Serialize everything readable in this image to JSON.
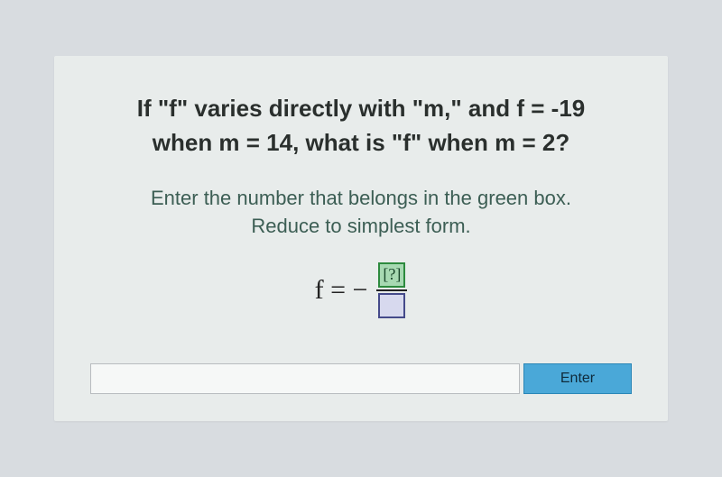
{
  "question": {
    "line1": "If \"f\" varies directly with \"m,\" and f = -19",
    "line2": "when m = 14, what is \"f\" when m = 2?"
  },
  "instruction": {
    "line1": "Enter the number that belongs in the green box.",
    "line2": "Reduce to simplest form."
  },
  "equation": {
    "lhs": "f = −",
    "numerator_placeholder": "[?]",
    "denominator_placeholder": ""
  },
  "input": {
    "value": "",
    "placeholder": ""
  },
  "enter_label": "Enter"
}
